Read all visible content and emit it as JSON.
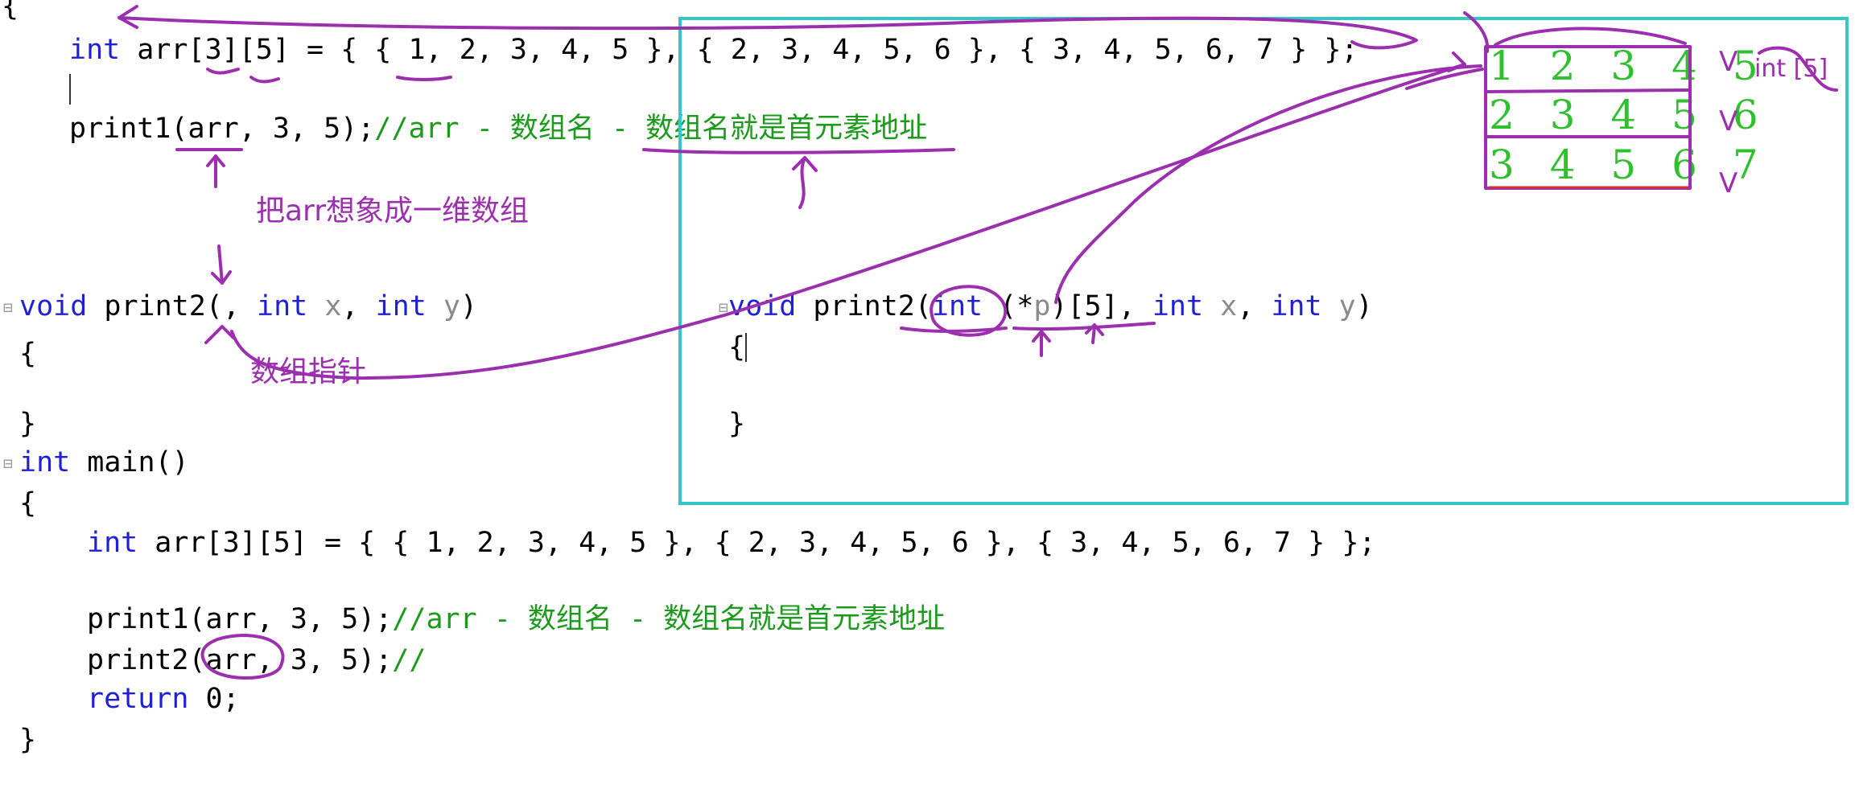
{
  "editor": {
    "top_brace": "{",
    "top_decl": {
      "kw_int": "int",
      "rest": " arr[3][5] = { { 1, 2, 3, 4, 5 }, { 2, 3, 4, 5, 6 }, { 3, 4, 5, 6, 7 } };"
    },
    "top_print1": {
      "code": "print1(arr, 3, 5);",
      "comment": "//arr - 数组名 - 数组名就是首元素地址"
    },
    "print2_left": {
      "kw_void": "void",
      "name": " print2(",
      "cursor_sep": ", ",
      "kw_int1": "int",
      "x": " x",
      "comma": ", ",
      "kw_int2": "int",
      "y": " y",
      "close": ")"
    },
    "left_open": "{",
    "left_close": "}",
    "main_sig": {
      "kw_int": "int",
      "rest": " main()"
    },
    "main_open": "{",
    "main_decl": {
      "kw_int": "int",
      "rest": " arr[3][5] = { { 1, 2, 3, 4, 5 }, { 2, 3, 4, 5, 6 }, { 3, 4, 5, 6, 7 } };"
    },
    "main_print1": {
      "code": "print1(arr, 3, 5);",
      "comment": "//arr - 数组名 - 数组名就是首元素地址"
    },
    "main_print2": {
      "code": "print2(arr, 3, 5);",
      "comment": "//"
    },
    "main_return": {
      "kw": "return",
      "rest": " 0;"
    },
    "main_close": "}"
  },
  "box": {
    "sig": {
      "kw_void": "void",
      "name": " print2(",
      "kw_int": "int",
      "paren": " (*",
      "p": "p",
      "after_p": ")[5], ",
      "kw_int2": "int",
      "x": " x",
      "comma": ", ",
      "kw_int3": "int",
      "y": " y",
      "close": ")"
    },
    "open": "{",
    "close": "}"
  },
  "annotations": {
    "imagine_1d": "把arr想象成一维数组",
    "array_pointer": "数组指针",
    "int5": "int [5]"
  },
  "grid_rows": [
    "1 2 3 4 5",
    "2 3 4 5 6",
    "3 4 5 6 7"
  ],
  "checks": [
    "V",
    "V",
    "V"
  ],
  "colors": {
    "keyword": "#1f1fd6",
    "comment": "#1b9a1b",
    "ink": "#9b2fae",
    "box_border": "#33c6cc",
    "grid_digits": "#2fbf2f"
  }
}
